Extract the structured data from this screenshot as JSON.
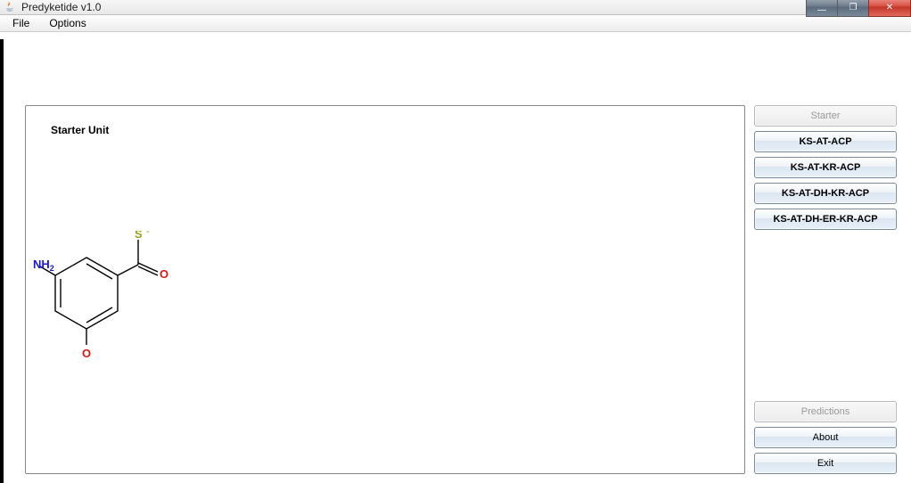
{
  "window": {
    "title": "Predyketide v1.0"
  },
  "menubar": {
    "file": "File",
    "options": "Options"
  },
  "canvas": {
    "title": "Starter Unit"
  },
  "molecule": {
    "nh2": "NH",
    "nh2_sub": "2",
    "s_label": "S",
    "s_minus": "-",
    "o_top": "O",
    "o_bottom": "O"
  },
  "sidebar": {
    "starter": "Starter",
    "btn1": "KS-AT-ACP",
    "btn2": "KS-AT-KR-ACP",
    "btn3": "KS-AT-DH-KR-ACP",
    "btn4": "KS-AT-DH-ER-KR-ACP",
    "predictions": "Predictions",
    "about": "About",
    "exit": "Exit"
  },
  "win_controls": {
    "min": "—",
    "max": "❐",
    "close": "✕"
  }
}
